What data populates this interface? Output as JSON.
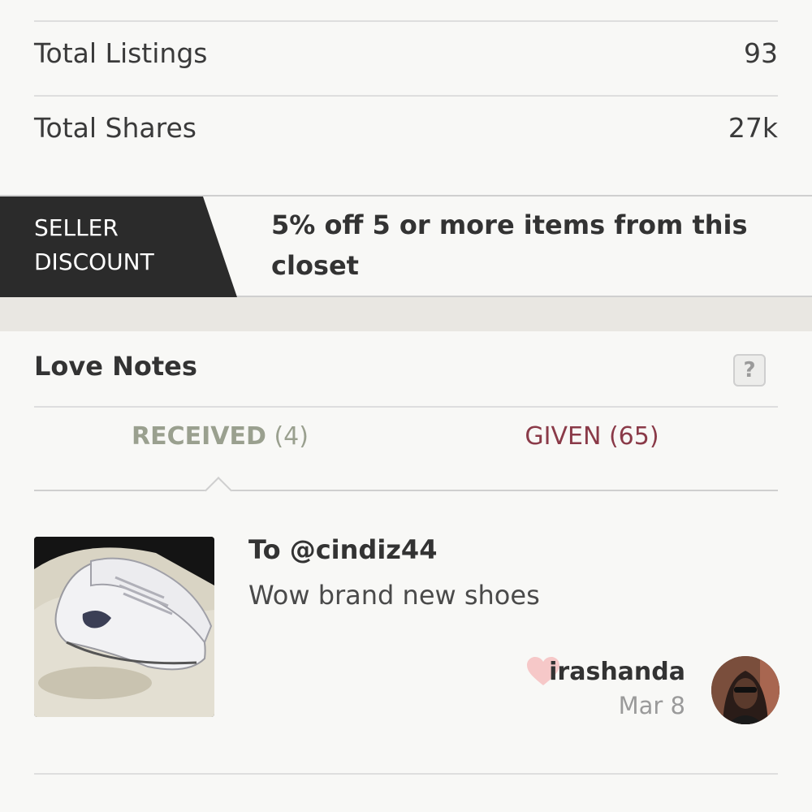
{
  "stats": [
    {
      "label": "Total Listings",
      "value": "93"
    },
    {
      "label": "Total Shares",
      "value": "27k"
    }
  ],
  "seller_discount": {
    "tag_line1": "SELLER",
    "tag_line2": "DISCOUNT",
    "text": "5% off 5 or more items from this closet"
  },
  "love_notes": {
    "title": "Love Notes",
    "help_label": "?",
    "tabs": {
      "received_label": "RECEIVED",
      "received_count": "(4)",
      "given_label": "GIVEN (65)"
    },
    "notes": [
      {
        "to": "To @cindiz44",
        "message": "Wow brand new shoes",
        "author": "irashanda",
        "date": "Mar 8",
        "thumbnail_icon": "shoe-photo",
        "heart_color": "#f6c8c8"
      }
    ]
  },
  "colors": {
    "given_accent": "#8a3a48",
    "received_muted": "#9aa08f",
    "discount_tag_bg": "#2b2b2b"
  }
}
